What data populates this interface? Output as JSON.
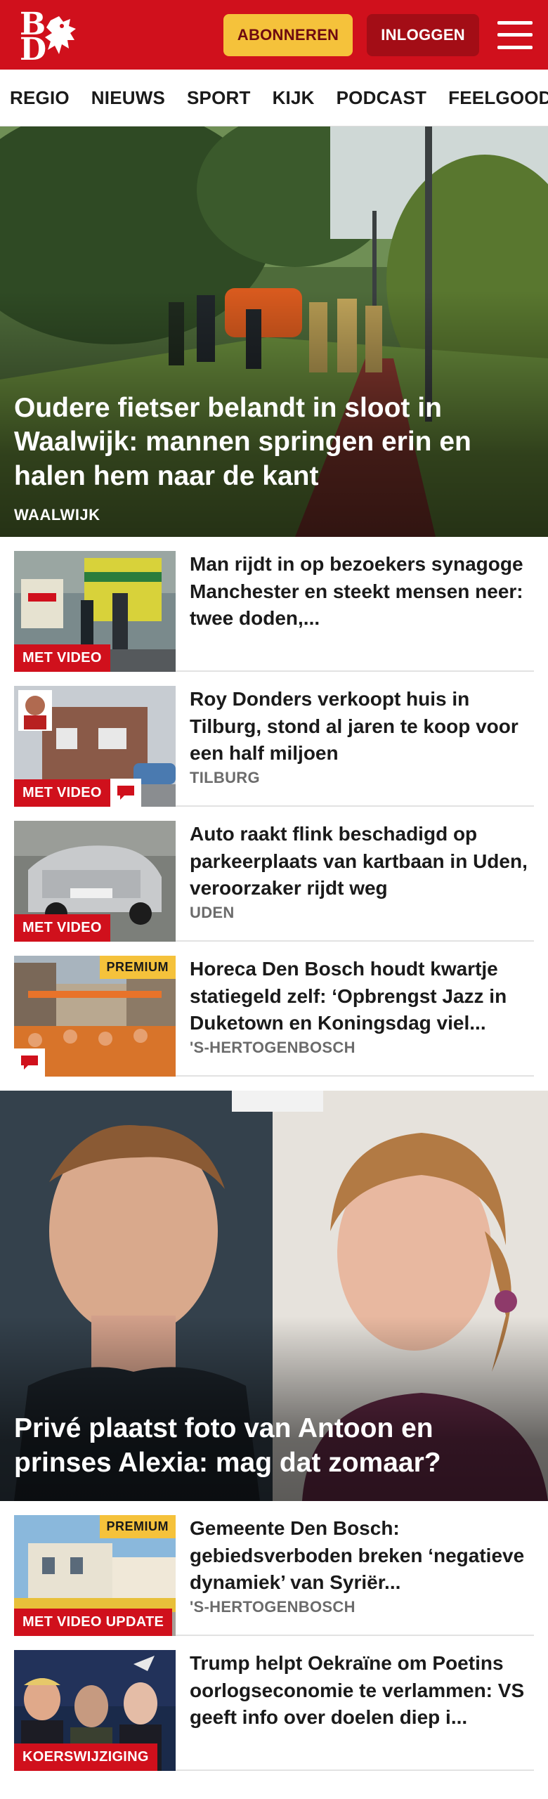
{
  "header": {
    "logo_letters": "BD",
    "subscribe_label": "ABONNEREN",
    "login_label": "INLOGGEN"
  },
  "nav": [
    "REGIO",
    "NIEUWS",
    "SPORT",
    "KIJK",
    "PODCAST",
    "FEELGOOD"
  ],
  "hero": {
    "title": "Oudere fietser belandt in sloot in Waalwijk: mannen springen erin en halen hem naar de kant",
    "tag": "WAALWIJK"
  },
  "articles": [
    {
      "title": "Man rijdt in op bezoekers synagoge Manchester en steekt mensen neer: twee doden,...",
      "tag": "",
      "badge": "MET VIDEO",
      "premium": "",
      "comment": false
    },
    {
      "title": "Roy Donders verkoopt huis in Tilburg, stond al jaren te koop voor een half miljoen",
      "tag": "TILBURG",
      "badge": "MET VIDEO",
      "premium": "",
      "comment": true
    },
    {
      "title": "Auto raakt flink beschadigd op parkeerplaats van kartbaan in Uden, veroorzaker rijdt weg",
      "tag": "UDEN",
      "badge": "MET VIDEO",
      "premium": "",
      "comment": false
    },
    {
      "title": "Horeca Den Bosch houdt kwartje statiegeld zelf: ‘Opbrengst Jazz in Duketown en Koningsdag viel...",
      "tag": "'S-HERTOGENBOSCH",
      "badge": "",
      "premium": "PREMIUM",
      "comment": true
    }
  ],
  "feature": {
    "title": "Privé plaatst foto van Antoon en prinses Alexia: mag dat zomaar?"
  },
  "articles2": [
    {
      "title": "Gemeente Den Bosch: gebiedsverboden breken ‘negatieve dynamiek’ van Syriër...",
      "tag": "'S-HERTOGENBOSCH",
      "badge": "MET VIDEO UPDATE",
      "premium": "PREMIUM"
    },
    {
      "title": "Trump helpt Oekraïne om Poetins oorlogseconomie te verlammen: VS geeft info over doelen diep i...",
      "tag": "",
      "badge": "KOERSWIJZIGING",
      "premium": ""
    }
  ],
  "colors": {
    "brand_red": "#d0101c",
    "premium_yellow": "#f5c23b",
    "login_dark_red": "#a30d16"
  },
  "icons": [
    "lion-logo-icon",
    "menu-icon",
    "comment-icon"
  ]
}
